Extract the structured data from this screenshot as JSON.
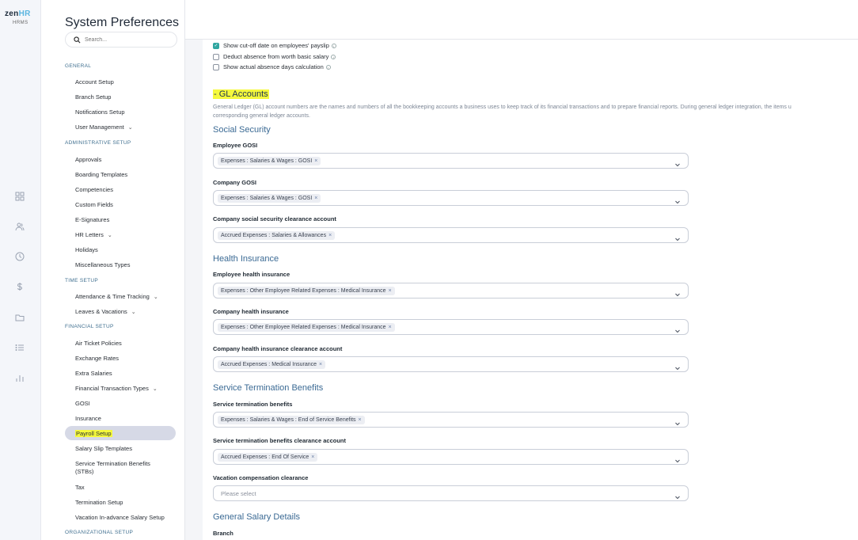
{
  "brand": {
    "zen": "zen",
    "hr": "HR",
    "sub": "HRMS"
  },
  "rail_icons": [
    "grid-icon",
    "people-icon",
    "clock-icon",
    "dollar-icon",
    "folder-icon",
    "list-icon",
    "bar-chart-icon"
  ],
  "sidebar": {
    "title": "System Preferences",
    "search_placeholder": "Search...",
    "sections": {
      "general": "GENERAL",
      "administrative": "ADMINISTRATIVE SETUP",
      "time": "TIME SETUP",
      "financial": "FINANCIAL SETUP",
      "organizational": "ORGANIZATIONAL SETUP"
    },
    "items": {
      "account_setup": "Account Setup",
      "branch_setup": "Branch Setup",
      "notifications_setup": "Notifications Setup",
      "user_management": "User Management",
      "approvals": "Approvals",
      "boarding_templates": "Boarding Templates",
      "competencies": "Competencies",
      "custom_fields": "Custom Fields",
      "e_signatures": "E-Signatures",
      "hr_letters": "HR Letters",
      "holidays": "Holidays",
      "misc_types": "Miscellaneous Types",
      "attendance": "Attendance & Time Tracking",
      "leaves": "Leaves & Vacations",
      "air_ticket": "Air Ticket Policies",
      "exchange_rates": "Exchange Rates",
      "extra_salaries": "Extra Salaries",
      "fin_transaction": "Financial Transaction Types",
      "gosi": "GOSI",
      "insurance": "Insurance",
      "payroll_setup": "Payroll Setup",
      "salary_slip": "Salary Slip Templates",
      "stb_line1": "Service Termination Benefits",
      "stb_line2": "(STBs)",
      "tax": "Tax",
      "termination_setup": "Termination Setup",
      "vacation_advance": "Vacation In-advance Salary Setup"
    }
  },
  "checkboxes": {
    "cutoff": {
      "label": "Show cut-off date on employees' payslip",
      "checked": true
    },
    "deduct": {
      "label": "Deduct absence from worth basic salary",
      "checked": false
    },
    "actual": {
      "label": "Show actual absence days calculation",
      "checked": false
    }
  },
  "gl": {
    "title": "- GL Accounts",
    "description_1": "General Ledger (GL) account numbers are the names and numbers of all the bookkeeping accounts a business uses to keep track of its financial transactions and to prepare financial reports. During general ledger integration, the items u",
    "description_2": "corresponding general ledger accounts."
  },
  "groups": {
    "social": "Social Security",
    "health": "Health Insurance",
    "stb": "Service Termination Benefits",
    "general_salary": "General Salary Details"
  },
  "fields": {
    "employee_gosi": {
      "label": "Employee GOSI",
      "value": "Expenses : Salaries & Wages : GOSI"
    },
    "company_gosi": {
      "label": "Company GOSI",
      "value": "Expenses : Salaries & Wages : GOSI"
    },
    "company_ss_clearance": {
      "label": "Company social security clearance account",
      "value": "Accrued Expenses : Salaries & Allowances"
    },
    "employee_health": {
      "label": "Employee health insurance",
      "value": "Expenses : Other Employee Related Expenses : Medical Insurance"
    },
    "company_health": {
      "label": "Company health insurance",
      "value": "Expenses : Other Employee Related Expenses : Medical Insurance"
    },
    "company_health_clearance": {
      "label": "Company health insurance clearance account",
      "value": "Accrued Expenses : Medical Insurance"
    },
    "stb": {
      "label": "Service termination benefits",
      "value": "Expenses : Salaries & Wages : End of Service Benefits"
    },
    "stb_clearance": {
      "label": "Service termination benefits clearance account",
      "value": "Accrued Expenses : End Of Service"
    },
    "vacation_comp": {
      "label": "Vacation compensation clearance",
      "placeholder": "Please select"
    },
    "branch": {
      "label": "Branch"
    }
  },
  "colors": {
    "accent_teal": "#2fa6a0",
    "group_heading": "#3b6a94",
    "highlight": "#f5f93c",
    "active_item_bg": "#d6d9e6"
  }
}
